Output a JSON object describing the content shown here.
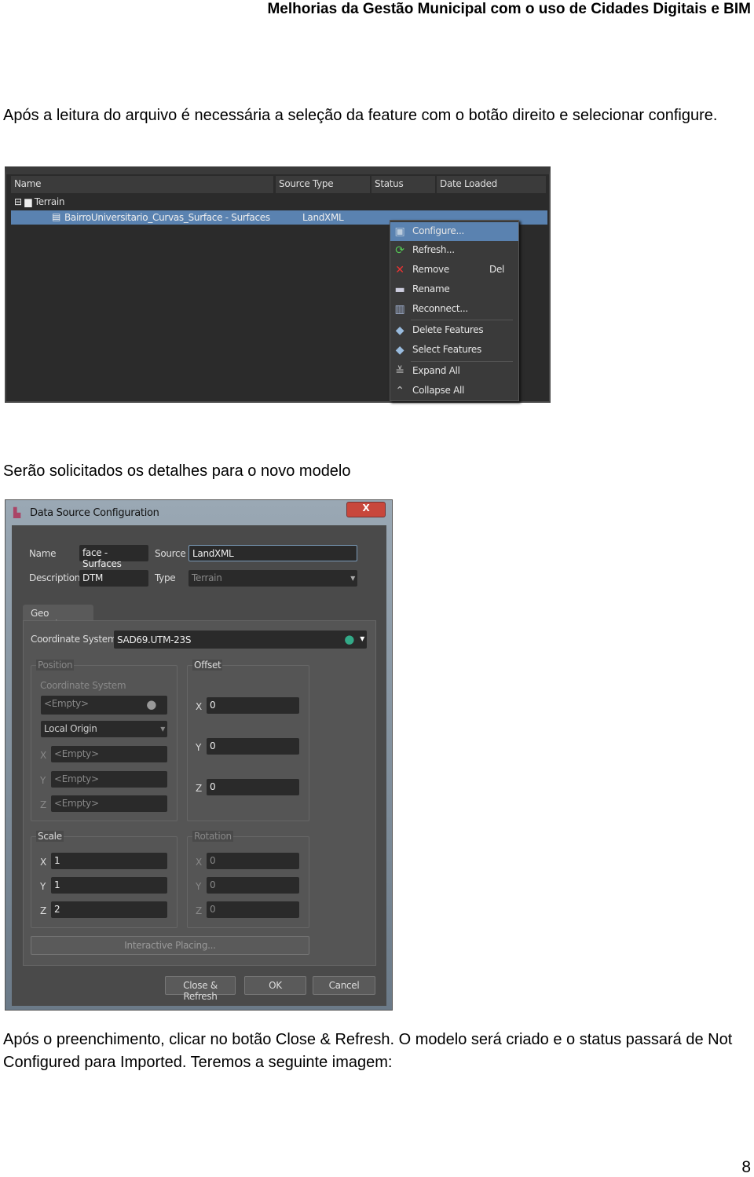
{
  "header": "Melhorias da Gestão Municipal com o uso de Cidades Digitais e BIM",
  "para1": "Após a leitura do arquivo é necessária a seleção da feature com o botão direito e selecionar configure.",
  "para2": "Serão solicitados os detalhes para o novo modelo",
  "para3": "Após o preenchimento, clicar no botão Close & Refresh. O modelo será criado e o status passará de Not Configured para Imported. Teremos a seguinte imagem:",
  "page_number": "8",
  "shot1": {
    "columns": [
      "Name",
      "Source Type",
      "Status",
      "Date Loaded"
    ],
    "tree": {
      "group": "Terrain",
      "item": "BairroUniversitario_Curvas_Surface - Surfaces",
      "item_source": "LandXML"
    },
    "menu": [
      {
        "label": "Configure...",
        "icon": "configure-icon"
      },
      {
        "label": "Refresh...",
        "icon": "refresh-icon"
      },
      {
        "label": "Remove",
        "shortcut": "Del",
        "icon": "remove-x-icon"
      },
      {
        "label": "Rename",
        "icon": "rename-icon"
      },
      {
        "label": "Reconnect...",
        "icon": "reconnect-icon"
      },
      {
        "label": "Delete Features",
        "icon": "delete-features-icon"
      },
      {
        "label": "Select Features",
        "icon": "select-features-icon"
      },
      {
        "label": "Expand All",
        "icon": "expand-all-icon"
      },
      {
        "label": "Collapse All",
        "icon": "collapse-all-icon"
      }
    ]
  },
  "dialog": {
    "title": "Data Source Configuration",
    "close": "X",
    "name_label": "Name",
    "name_value": "face - Surfaces",
    "source_label": "Source",
    "source_value": "LandXML",
    "desc_label": "Description",
    "desc_value": "DTM",
    "type_label": "Type",
    "type_value": "Terrain",
    "tab": "Geo Location",
    "cs_label": "Coordinate System",
    "cs_value": "SAD69.UTM-23S",
    "position": {
      "title": "Position",
      "cs_label": "Coordinate System",
      "cs_value": "<Empty>",
      "origin": "Local Origin",
      "x": "<Empty>",
      "y": "<Empty>",
      "z": "<Empty>"
    },
    "offset": {
      "title": "Offset",
      "x": "0",
      "y": "0",
      "z": "0"
    },
    "scale": {
      "title": "Scale",
      "x": "1",
      "y": "1",
      "z": "2"
    },
    "rotation": {
      "title": "Rotation",
      "x": "0",
      "y": "0",
      "z": "0"
    },
    "axes": {
      "x": "X",
      "y": "Y",
      "z": "Z"
    },
    "interactive": "Interactive Placing...",
    "close_refresh": "Close & Refresh",
    "ok": "OK",
    "cancel": "Cancel"
  }
}
